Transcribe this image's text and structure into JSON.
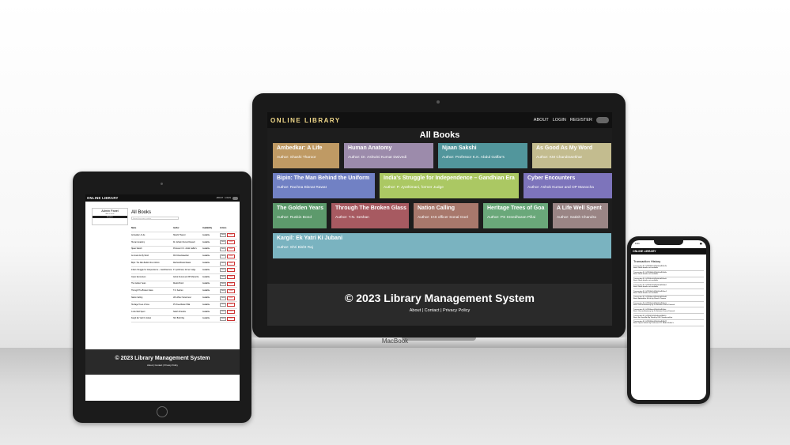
{
  "laptop": {
    "brand": "MacBook",
    "logo": "ONLINE LIBRARY",
    "nav": [
      "ABOUT",
      "LOGIN",
      "REGISTER"
    ],
    "page_title": "All Books",
    "rows": [
      [
        {
          "title": "Ambedkar: A Life",
          "author": "Author: Shashi Tharoor",
          "color": "#bf9a64"
        },
        {
          "title": "Human Anatomy",
          "author": "Author: Dr. Ashwini Kumar Dwivedi",
          "color": "#9c8bab"
        },
        {
          "title": "Njaan Sakshi",
          "author": "Author: Professor K.K. Abdul Gaffar's",
          "color": "#52969c"
        },
        {
          "title": "As Good As My Word",
          "author": "Author: KM Chandrasekhar",
          "color": "#c3bc8f"
        }
      ],
      [
        {
          "title": "Bipin: The Man Behind the Uniform",
          "author": "Author: Rachna Bisnat Rawat",
          "color": "#7181c4"
        },
        {
          "title": "India's Struggle for Independence – Gandhian Era",
          "author": "Author: P. Jyothimani, former Judge",
          "color": "#abc863"
        },
        {
          "title": "Cyber Encounters",
          "author": "Author: Ashok Kumar and OP Manocha",
          "color": "#7d74bb"
        }
      ],
      [
        {
          "title": "The Golden Years",
          "author": "Author: Ruskin Bond",
          "color": "#5d9a6c"
        },
        {
          "title": "Through The Broken Glass",
          "author": "Author: T.N. Seshan",
          "color": "#a75a61"
        },
        {
          "title": "Nation Calling",
          "author": "Author: IAS officer Sonal Goel",
          "color": "#a8786c"
        },
        {
          "title": "Heritage Trees of Goa",
          "author": "Author: PS Sreedharan Pillai",
          "color": "#6aa87a"
        },
        {
          "title": "A Life Well Spent",
          "author": "Author: Satish Chandra",
          "color": "#9a8585"
        }
      ],
      [
        {
          "title": "Kargil: Ek Yatri Ki Jubani",
          "author": "Author: Shri Bisht Raj",
          "color": "#7ab3c0"
        }
      ]
    ],
    "footer": {
      "copyright": "© 2023 Library Management System",
      "links": "About  |  Contact  |  Privacy Policy"
    }
  },
  "tablet": {
    "logo": "ONLINE LIBRARY",
    "nav": [
      "ABOUT",
      "LOGIN"
    ],
    "admin": {
      "title": "Admin Panel",
      "link": "Add a book",
      "active": "Booklist"
    },
    "title": "All Books",
    "search_placeholder": "Search by name, author",
    "headers": [
      "Name",
      "Author",
      "Availability",
      "Actions"
    ],
    "rows": [
      {
        "name": "Ambedkar: A Life",
        "author": "Shashi Tharoor",
        "status": "Available"
      },
      {
        "name": "Human Anatomy",
        "author": "Dr. Ashwini Kumar Dwivedi",
        "status": "Available"
      },
      {
        "name": "Njaan Sakshi",
        "author": "Professor K.K. Abdul Gaffar's",
        "status": "Available"
      },
      {
        "name": "As Good As My Word",
        "author": "KM Chandrasekhar",
        "status": "Available"
      },
      {
        "name": "Bipin: The Man Behind the Uniform",
        "author": "Rachna Bisnat Rawat",
        "status": "Available"
      },
      {
        "name": "India's Struggle for Independence – Gandhian Era",
        "author": "P. Jyothimani, former Judge",
        "status": "Available"
      },
      {
        "name": "Cyber Encounters",
        "author": "Ashok Kumar and OP Manocha",
        "status": "Available"
      },
      {
        "name": "The Golden Years",
        "author": "Ruskin Bond",
        "status": "Available"
      },
      {
        "name": "Through The Broken Glass",
        "author": "T.N. Seshan",
        "status": "Available"
      },
      {
        "name": "Nation Calling",
        "author": "IAS officer Sonal Goel",
        "status": "Available"
      },
      {
        "name": "Heritage Trees of Goa",
        "author": "PS Sreedharan Pillai",
        "status": "Available"
      },
      {
        "name": "A Life Well Spent",
        "author": "Satish Chandra",
        "status": "Available"
      },
      {
        "name": "Kargil: Ek Yatri Ki Jubani",
        "author": "Shri Bisht Raj",
        "status": "Available"
      }
    ],
    "btn_edit": "Issue",
    "btn_delete": "Delete",
    "footer": {
      "copyright": "© 2023 Library Management System",
      "links": "About  |  Contact  |  Privacy Policy"
    }
  },
  "phone": {
    "time": "9:41",
    "logo": "ONLINE LIBRARY",
    "title": "Transaction History",
    "transactions": [
      {
        "id": "Transaction ID: 6476f4b2e5f2fe8c4d1f8a7b",
        "book": "Book: Book details not available"
      },
      {
        "id": "Transaction ID: 6476f4b8e5f2fe8c4d1f8a8e",
        "book": "Book: Book details not available"
      },
      {
        "id": "Transaction ID: 6476f4c3e5f2fe8c4d1f8aa5",
        "book": "Book: Book details not available"
      },
      {
        "id": "Transaction ID: 6476f4c9e5f2fe8c4d1f8ab1",
        "book": "Book: Book details not available"
      },
      {
        "id": "Transaction ID: 6476f4d2e5f2fe8c4d1f8ac4",
        "book": "Book: Book details not available"
      },
      {
        "id": "Transaction ID: 6476f4dce5f2fe8c4d1f8ad9",
        "book": "Book: Ambedkar: A Life by Shashi Tharoor"
      },
      {
        "id": "Transaction ID: 6476f4e5e5f2fe8c4d1f8aeb",
        "book": "Book: Human Anatomy by Dr. Ashwini Kumar Dwivedi"
      },
      {
        "id": "Transaction ID: 6476f4eee5f2fe8c4d1f8afe",
        "book": "Book: Human Anatomy by Dr. Ashwini Kumar Dwivedi"
      },
      {
        "id": "Transaction ID: 6476f4f7e5f2fe8c4d1f8b10",
        "book": "Book: As Good As My Word by KM Chandrasekhar"
      },
      {
        "id": "Transaction ID: 6476f500e5f2fe8c4d1f8b22",
        "book": "Book: Njaan Sakshi by Professor K.K. Abdul Gaffar's"
      }
    ]
  }
}
